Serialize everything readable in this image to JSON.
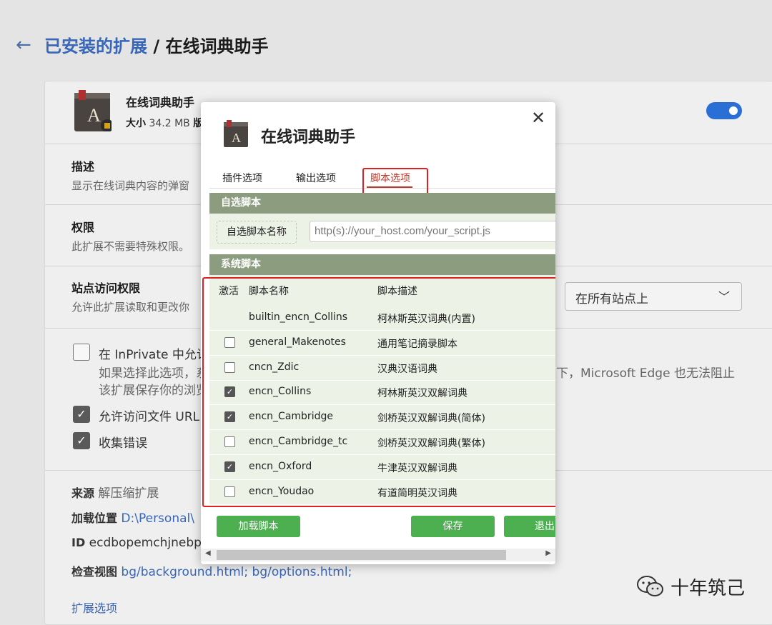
{
  "header": {
    "parent_link": "已安装的扩展",
    "separator": " / ",
    "current": "在线词典助手"
  },
  "extension": {
    "name": "在线词典助手",
    "size_label": "大小",
    "size_value": "34.2 MB",
    "size_tail": "版",
    "enabled": true
  },
  "sections": {
    "description": {
      "title": "描述",
      "text": "显示在线词典内容的弹窗"
    },
    "permissions": {
      "title": "权限",
      "text": "此扩展不需要特殊权限。"
    },
    "site_access": {
      "title": "站点访问权限",
      "text": "允许此扩展读取和更改你",
      "select_value": "在所有站点上"
    },
    "inprivate": {
      "label": "在 InPrivate 中允许",
      "desc_line1": "如果选择此选项，系",
      "desc_tail": "下，Microsoft Edge 也无法阻止",
      "desc_line2": "该扩展保存你的浏览"
    },
    "file_urls": {
      "label": "允许访问文件 URL"
    },
    "collect_errors": {
      "label": "收集错误"
    },
    "source": {
      "label": "来源",
      "value": "解压缩扩展"
    },
    "load_path": {
      "label": "加载位置",
      "value": "D:\\Personal\\"
    },
    "id": {
      "label": "ID",
      "value": "ecdbopemchjnebp"
    },
    "inspect": {
      "label": "检查视图",
      "value": "bg/background.html;  bg/options.html;"
    },
    "ext_options": "扩展选项"
  },
  "modal": {
    "title": "在线词典助手",
    "close_glyph": "✕",
    "tabs": [
      "插件选项",
      "输出选项",
      "脚本选项"
    ],
    "active_tab": 2,
    "custom_section": {
      "title": "自选脚本",
      "label": "自选脚本名称",
      "placeholder": "http(s)://your_host.com/your_script.js"
    },
    "system_section": {
      "title": "系统脚本",
      "columns": [
        "激活",
        "脚本名称",
        "脚本描述"
      ],
      "rows": [
        {
          "name": "builtin_encn_Collins",
          "desc": "柯林斯英汉词典(内置)",
          "checkbox": false,
          "checked": false
        },
        {
          "name": "general_Makenotes",
          "desc": "通用笔记摘录脚本",
          "checkbox": true,
          "checked": false
        },
        {
          "name": "cncn_Zdic",
          "desc": "汉典汉语词典",
          "checkbox": true,
          "checked": false
        },
        {
          "name": "encn_Collins",
          "desc": "柯林斯英汉双解词典",
          "checkbox": true,
          "checked": true
        },
        {
          "name": "encn_Cambridge",
          "desc": "剑桥英汉双解词典(简体)",
          "checkbox": true,
          "checked": true
        },
        {
          "name": "encn_Cambridge_tc",
          "desc": "剑桥英汉双解词典(繁体)",
          "checkbox": true,
          "checked": false
        },
        {
          "name": "encn_Oxford",
          "desc": "牛津英汉双解词典",
          "checkbox": true,
          "checked": true
        },
        {
          "name": "encn_Youdao",
          "desc": "有道简明英汉词典",
          "checkbox": true,
          "checked": false
        }
      ]
    },
    "buttons": {
      "load": "加载脚本",
      "save": "保存",
      "exit": "退出"
    }
  },
  "watermark": "十年筑己",
  "colors": {
    "accent_blue": "#3866b8",
    "toggle": "#2a6fd6",
    "section_header": "#8c9d7f",
    "section_body": "#edf2e7",
    "button_green": "#4caf50",
    "highlight_red": "#e02020"
  }
}
